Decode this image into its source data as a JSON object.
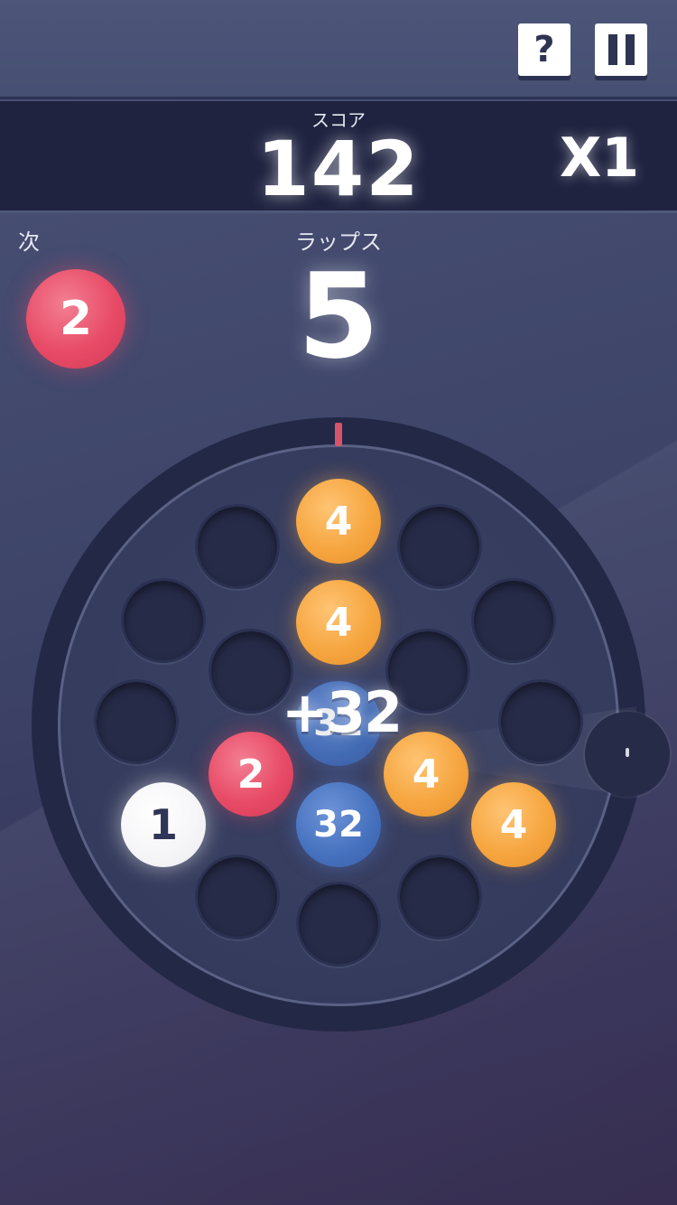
{
  "header": {
    "help_icon_glyph": "?",
    "help_label": "help",
    "pause_label": "pause"
  },
  "score": {
    "label": "スコア",
    "value": "142",
    "multiplier": "X1"
  },
  "next": {
    "label": "次",
    "value": "2",
    "color": "#e84b66"
  },
  "laps": {
    "label": "ラップス",
    "value": "5"
  },
  "board": {
    "balls": [
      {
        "value": "4",
        "color": "orange"
      },
      {
        "value": "4",
        "color": "orange"
      },
      {
        "value": "32",
        "color": "blue"
      },
      {
        "value": "2",
        "color": "red"
      },
      {
        "value": "4",
        "color": "orange"
      },
      {
        "value": "1",
        "color": "white"
      },
      {
        "value": "32",
        "color": "blue"
      },
      {
        "value": "4",
        "color": "orange"
      }
    ],
    "empty_slot_count": 11,
    "popup_score": "+32"
  },
  "colors": {
    "orange": "#f6a640",
    "red": "#e84b66",
    "blue": "#4470bd",
    "white": "#ffffff",
    "marker": "#d9536a"
  }
}
